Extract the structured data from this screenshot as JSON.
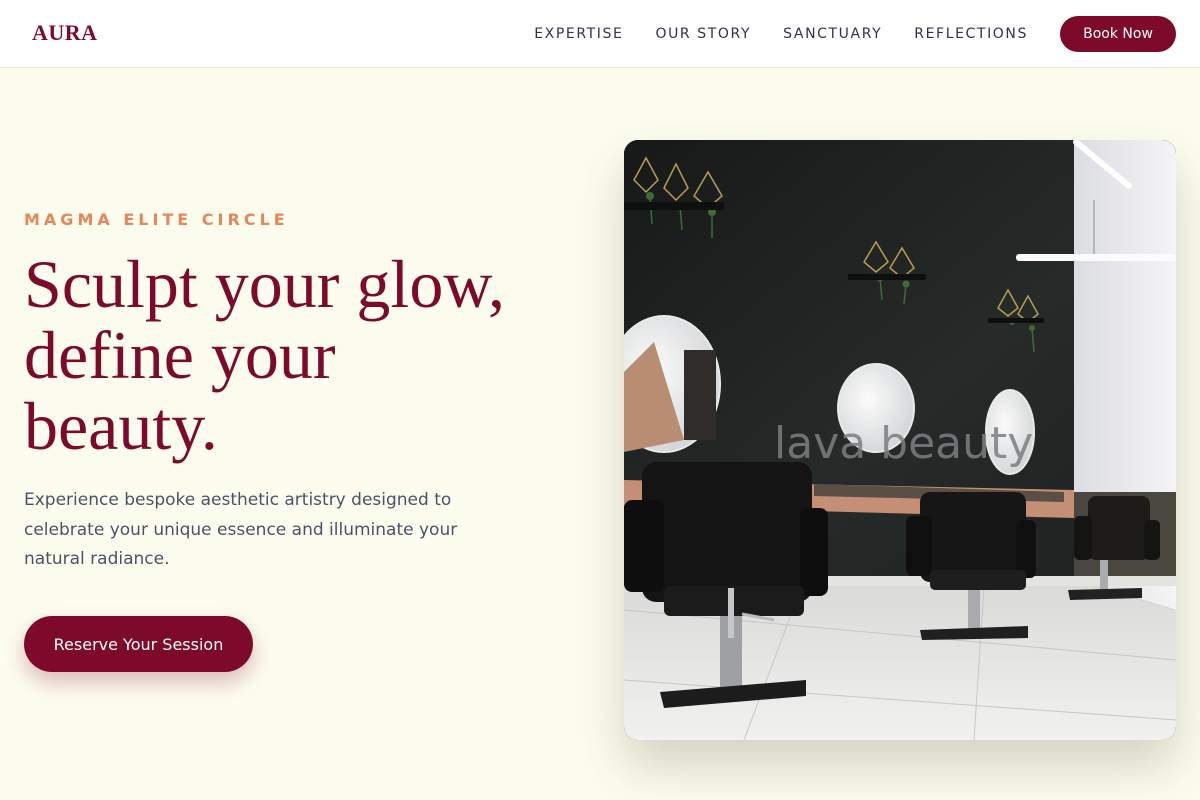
{
  "brand": {
    "name": "AURA"
  },
  "nav": {
    "links": [
      "EXPERTISE",
      "OUR STORY",
      "SANCTUARY",
      "REFLECTIONS"
    ],
    "book_label": "Book Now"
  },
  "hero": {
    "eyebrow": "MAGMA ELITE CIRCLE",
    "headline_lines": [
      "Sculpt your glow,",
      "define your",
      "beauty."
    ],
    "subcopy": "Experience bespoke aesthetic artistry designed to celebrate your unique essence and illuminate your natural radiance.",
    "cta_label": "Reserve Your Session",
    "image": {
      "description_icon": "salon-interior-photo",
      "wall_sign": "lava beauty"
    }
  },
  "colors": {
    "brand": "#7d0a2a",
    "accent": "#e8865a",
    "background": "#fdfdef",
    "body_text": "#4a5266",
    "nav_text": "#2f3545"
  }
}
